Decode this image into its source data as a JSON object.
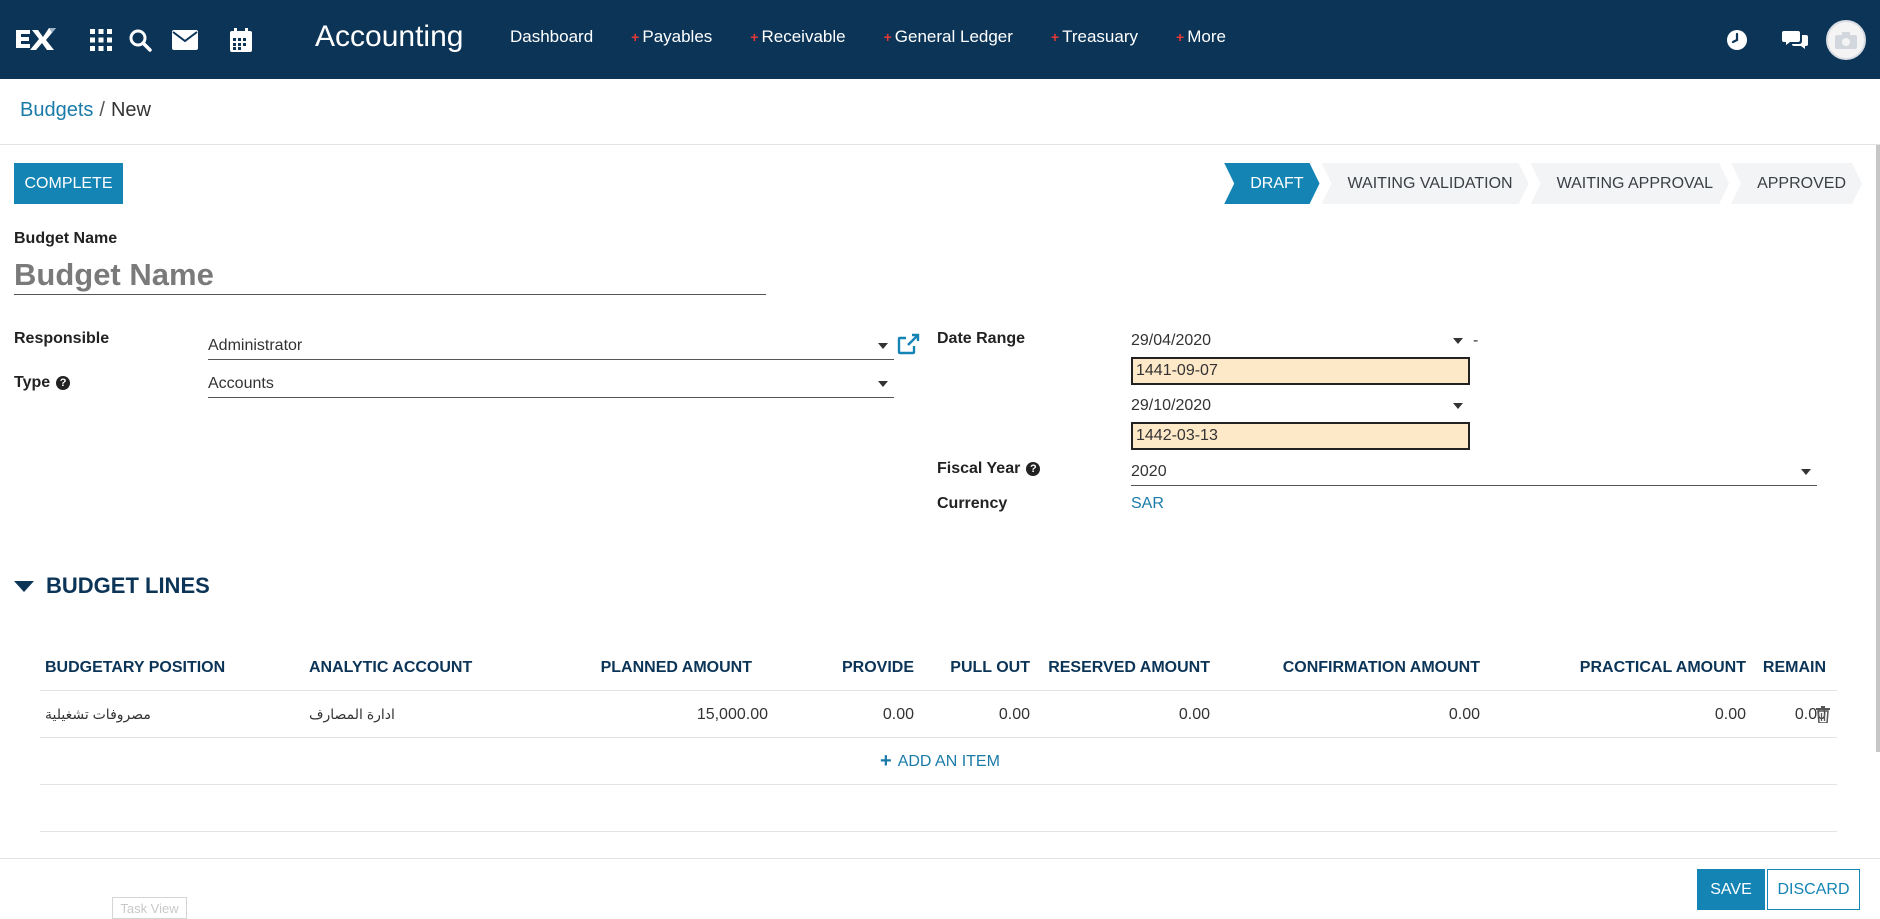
{
  "nav": {
    "app_title": "Accounting",
    "menu": [
      {
        "label": "Dashboard",
        "plus": false
      },
      {
        "label": "Payables",
        "plus": true
      },
      {
        "label": "Receivable",
        "plus": true
      },
      {
        "label": "General Ledger",
        "plus": true
      },
      {
        "label": "Treasuary",
        "plus": true
      },
      {
        "label": "More",
        "plus": true
      }
    ],
    "icons": [
      "apps-grid-icon",
      "search-icon",
      "mail-icon",
      "calendar-icon",
      "clock-icon",
      "chat-icon",
      "camera-icon"
    ]
  },
  "breadcrumb": {
    "parent": "Budgets",
    "separator": "/",
    "current": "New"
  },
  "toolbar": {
    "complete_label": "COMPLETE"
  },
  "stages": [
    {
      "label": "DRAFT",
      "active": true
    },
    {
      "label": "WAITING VALIDATION",
      "active": false
    },
    {
      "label": "WAITING APPROVAL",
      "active": false
    },
    {
      "label": "APPROVED",
      "active": false
    }
  ],
  "form": {
    "budget_name_label": "Budget Name",
    "budget_name_placeholder": "Budget Name",
    "responsible_label": "Responsible",
    "responsible_value": "Administrator",
    "type_label": "Type",
    "type_value": "Accounts",
    "date_range_label": "Date Range",
    "date_from": "29/04/2020",
    "date_from_hijri": "1441-09-07",
    "date_separator": "-",
    "date_to": "29/10/2020",
    "date_to_hijri": "1442-03-13",
    "fiscal_year_label": "Fiscal Year",
    "fiscal_year_value": "2020",
    "currency_label": "Currency",
    "currency_value": "SAR",
    "help_glyph": "?"
  },
  "budget_lines": {
    "title": "BUDGET LINES",
    "columns": [
      "BUDGETARY POSITION",
      "ANALYTIC ACCOUNT",
      "PLANNED AMOUNT",
      "PROVIDE",
      "PULL OUT",
      "RESERVED AMOUNT",
      "CONFIRMATION AMOUNT",
      "PRACTICAL AMOUNT",
      "REMAIN"
    ],
    "rows": [
      [
        "مصروفات تشغيلية",
        "ادارة المصارف",
        "15,000.00",
        "0.00",
        "0.00",
        "0.00",
        "0.00",
        "0.00",
        "0.00"
      ]
    ],
    "add_item_label": "ADD AN ITEM",
    "add_item_glyph": "+"
  },
  "footer": {
    "save_label": "SAVE",
    "discard_label": "DISCARD",
    "task_view_label": "Task View"
  },
  "colors": {
    "navbar": "#0b3457",
    "accent": "#1484b4",
    "link": "#1a7ba8",
    "hijri_bg": "#fde8c8"
  }
}
